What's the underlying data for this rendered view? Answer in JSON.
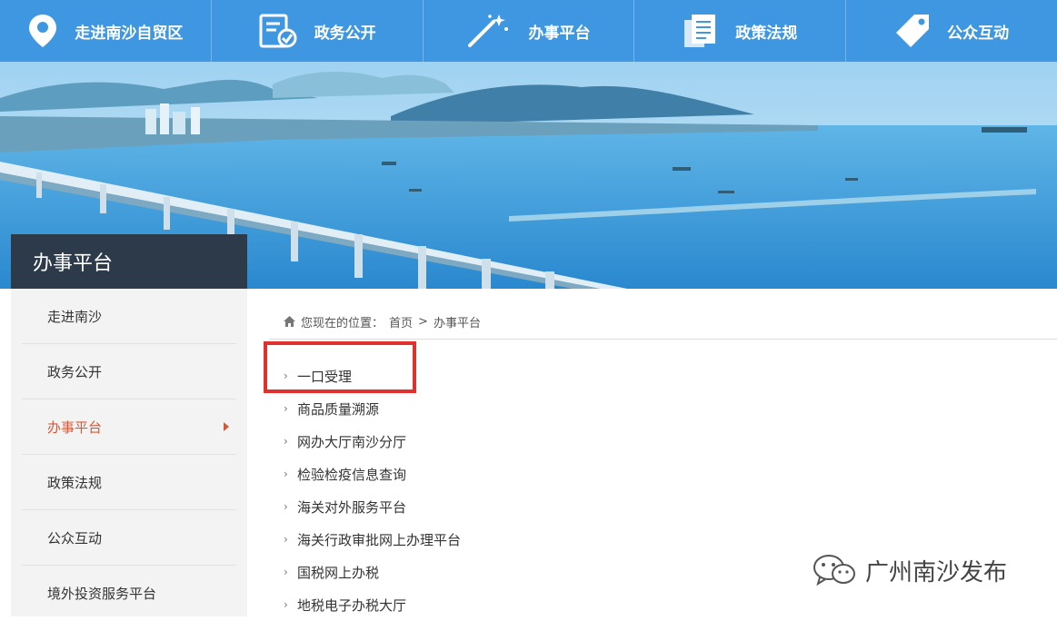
{
  "topnav": {
    "items": [
      {
        "label": "走进南沙自贸区",
        "icon": "location-pin-icon"
      },
      {
        "label": "政务公开",
        "icon": "document-check-icon"
      },
      {
        "label": "办事平台",
        "icon": "magic-wand-icon"
      },
      {
        "label": "政策法规",
        "icon": "documents-icon"
      },
      {
        "label": "公众互动",
        "icon": "tag-icon"
      }
    ]
  },
  "section_title": "办事平台",
  "sidebar": {
    "items": [
      {
        "label": "走进南沙"
      },
      {
        "label": "政务公开"
      },
      {
        "label": "办事平台",
        "active": true
      },
      {
        "label": "政策法规"
      },
      {
        "label": "公众互动"
      },
      {
        "label": "境外投资服务平台"
      }
    ]
  },
  "breadcrumb": {
    "prefix": "您现在的位置：",
    "home": "首页",
    "separator": ">",
    "current": "办事平台",
    "icon": "home-icon"
  },
  "services": {
    "bullet": "›",
    "items": [
      "一口受理",
      "商品质量溯源",
      "网办大厅南沙分厅",
      "检验检疫信息查询",
      "海关对外服务平台",
      "海关行政审批网上办理平台",
      "国税网上办税",
      "地税电子办税大厅"
    ]
  },
  "watermark": {
    "text": "广州南沙发布",
    "icon": "wechat-logo-icon"
  },
  "colors": {
    "nav_bg": "#3f97e2",
    "title_bg": "#2c3a4a",
    "active": "#d25a3a",
    "highlight": "#e0312c"
  }
}
